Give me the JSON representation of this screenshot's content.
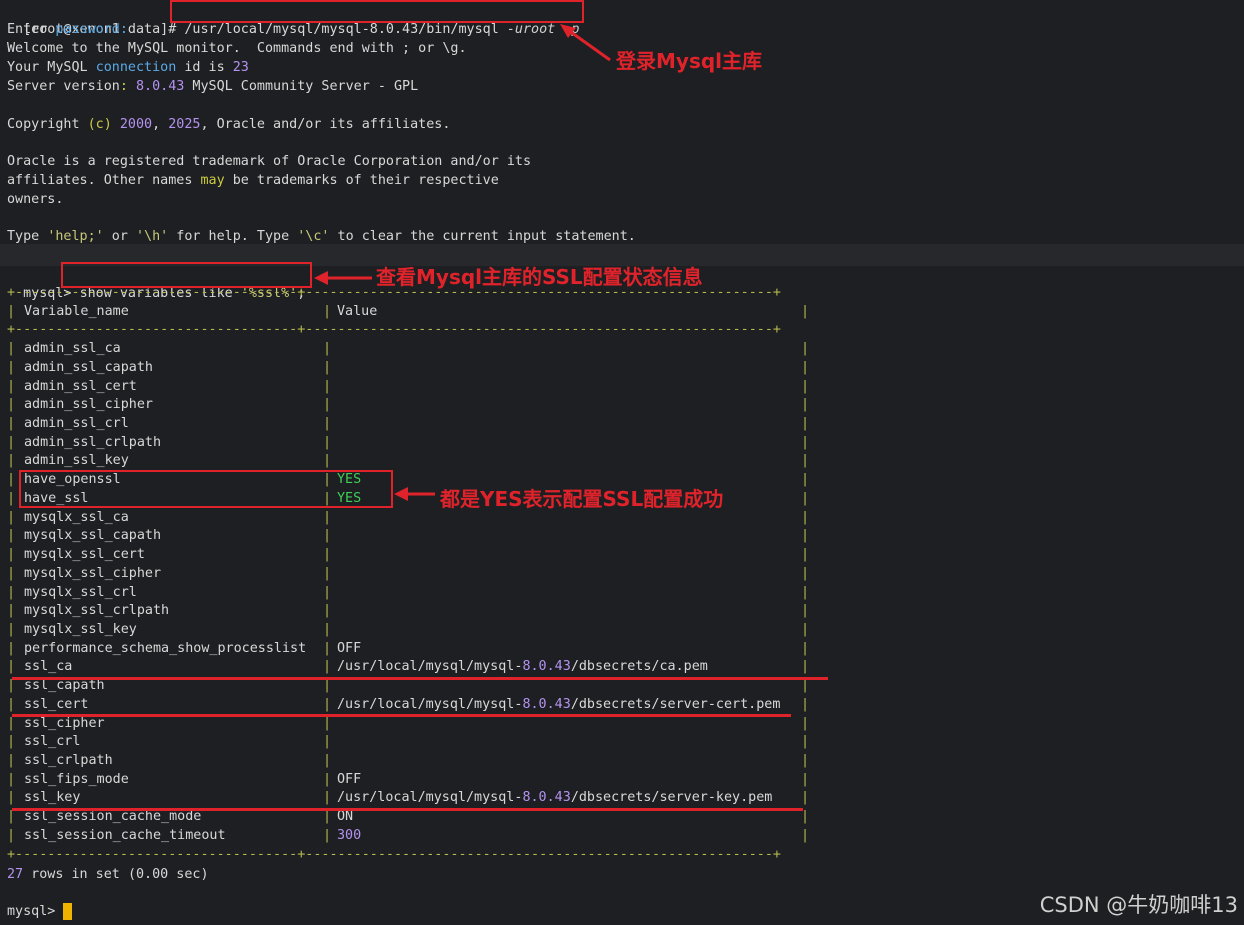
{
  "shell": {
    "prompt": "[root@xenon1 data]# ",
    "command": "/usr/local/mysql/mysql-8.0.43/bin/mysql",
    "args": " -uroot -p"
  },
  "banner": {
    "enter_pw_a": "Enter ",
    "enter_pw_b": "password:",
    "welcome": "Welcome to the MySQL monitor.  Commands end with ; or \\g.",
    "conn_a": "Your MySQL ",
    "conn_b": "connection",
    "conn_c": " id is ",
    "conn_id": "23",
    "ver_a": "Server version",
    "ver_b": ": ",
    "ver_num": "8.0.43",
    "ver_c": " MySQL Community Server - GPL",
    "copy_a": "Copyright ",
    "copy_b": "(c)",
    "copy_c": " ",
    "copy_y1": "2000",
    "copy_d": ", ",
    "copy_y2": "2025",
    "copy_e": ", Oracle and/or its affiliates.",
    "ora1": "Oracle is a registered trademark of Oracle Corporation and/or its",
    "ora2_a": "affiliates. Other names ",
    "ora2_b": "may",
    "ora2_c": " be trademarks of their respective",
    "ora3": "owners.",
    "help_a": "Type ",
    "help_b": "'help;'",
    "help_c": " or ",
    "help_d": "'\\h'",
    "help_e": " for help. Type ",
    "help_f": "'\\c'",
    "help_g": " to clear the current input statement."
  },
  "query": {
    "prompt": "mysql> ",
    "sql_a": "show variables like ",
    "sql_b": "'%ssl%'",
    "sql_c": ";"
  },
  "table": {
    "border": "+-----------------------------------+----------------------------------------------------------+",
    "headers": [
      "Variable_name",
      "Value"
    ],
    "rows": [
      [
        "admin_ssl_ca",
        ""
      ],
      [
        "admin_ssl_capath",
        ""
      ],
      [
        "admin_ssl_cert",
        ""
      ],
      [
        "admin_ssl_cipher",
        ""
      ],
      [
        "admin_ssl_crl",
        ""
      ],
      [
        "admin_ssl_crlpath",
        ""
      ],
      [
        "admin_ssl_key",
        ""
      ],
      [
        "have_openssl",
        "YES"
      ],
      [
        "have_ssl",
        "YES"
      ],
      [
        "mysqlx_ssl_ca",
        ""
      ],
      [
        "mysqlx_ssl_capath",
        ""
      ],
      [
        "mysqlx_ssl_cert",
        ""
      ],
      [
        "mysqlx_ssl_cipher",
        ""
      ],
      [
        "mysqlx_ssl_crl",
        ""
      ],
      [
        "mysqlx_ssl_crlpath",
        ""
      ],
      [
        "mysqlx_ssl_key",
        ""
      ],
      [
        "performance_schema_show_processlist",
        "OFF"
      ],
      [
        "ssl_ca",
        "/usr/local/mysql/mysql-8.0.43/dbsecrets/ca.pem"
      ],
      [
        "ssl_capath",
        ""
      ],
      [
        "ssl_cert",
        "/usr/local/mysql/mysql-8.0.43/dbsecrets/server-cert.pem"
      ],
      [
        "ssl_cipher",
        ""
      ],
      [
        "ssl_crl",
        ""
      ],
      [
        "ssl_crlpath",
        ""
      ],
      [
        "ssl_fips_mode",
        "OFF"
      ],
      [
        "ssl_key",
        "/usr/local/mysql/mysql-8.0.43/dbsecrets/server-key.pem"
      ],
      [
        "ssl_session_cache_mode",
        "ON"
      ],
      [
        "ssl_session_cache_timeout",
        "300"
      ]
    ]
  },
  "result": {
    "count": "27",
    "rows_a": " rows in set ",
    "time": "(0.00 sec)"
  },
  "final_prompt": "mysql> ",
  "annotations": {
    "login": "登录Mysql主库",
    "view": "查看Mysql主库的SSL配置状态信息",
    "yes": "都是YES表示配置SSL配置成功"
  },
  "watermark": "CSDN @牛奶咖啡13",
  "colors": {
    "accent": "#e0232b",
    "border": "#b5b84f",
    "yes": "#3ecf55",
    "number": "#b392f0",
    "keyword": "#5aa9e6"
  }
}
